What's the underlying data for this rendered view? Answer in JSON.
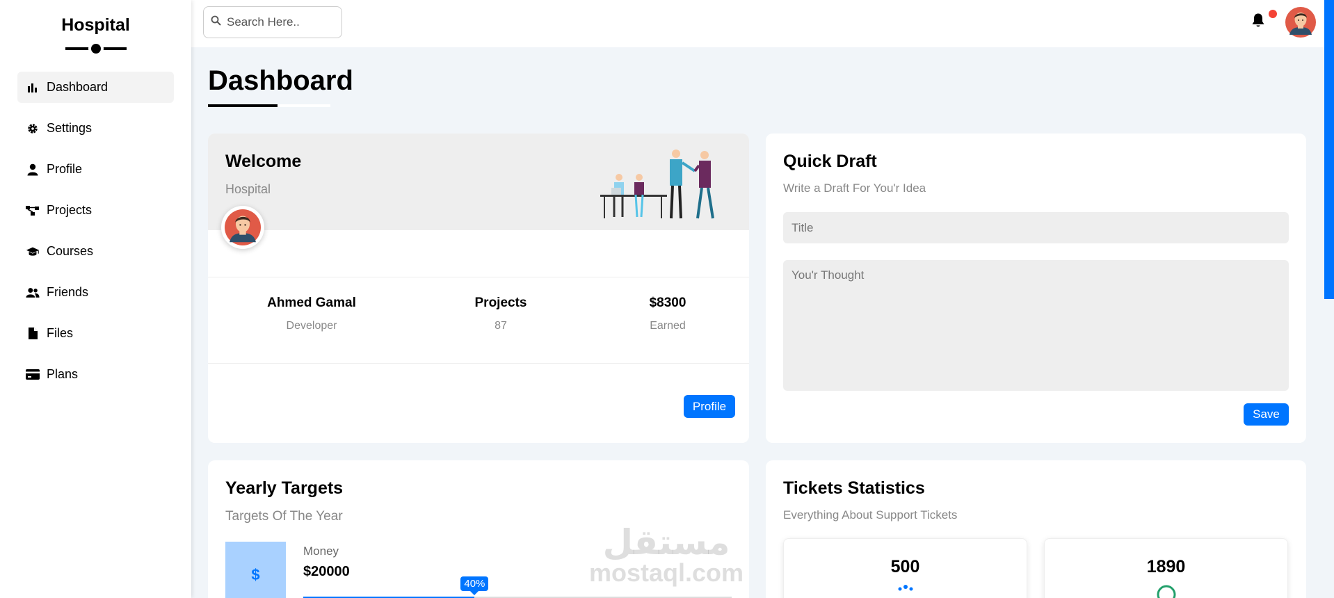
{
  "brand": {
    "name": "Hospital"
  },
  "sidebar": {
    "items": [
      {
        "label": "Dashboard",
        "icon": "chart-bar-icon",
        "active": true
      },
      {
        "label": "Settings",
        "icon": "gear-icon"
      },
      {
        "label": "Profile",
        "icon": "user-icon"
      },
      {
        "label": "Projects",
        "icon": "diagram-icon"
      },
      {
        "label": "Courses",
        "icon": "graduation-cap-icon"
      },
      {
        "label": "Friends",
        "icon": "users-icon"
      },
      {
        "label": "Files",
        "icon": "file-icon"
      },
      {
        "label": "Plans",
        "icon": "credit-card-icon"
      }
    ]
  },
  "header": {
    "search_placeholder": "Search Here.."
  },
  "page": {
    "title": "Dashboard"
  },
  "welcome": {
    "title": "Welcome",
    "subtitle": "Hospital",
    "stats": [
      {
        "value": "Ahmed Gamal",
        "label": "Developer"
      },
      {
        "value": "Projects",
        "label": "87"
      },
      {
        "value": "$8300",
        "label": "Earned"
      }
    ],
    "button": "Profile"
  },
  "draft": {
    "title": "Quick Draft",
    "subtitle": "Write a Draft For You'r Idea",
    "title_placeholder": "Title",
    "thought_placeholder": "You'r Thought",
    "button": "Save"
  },
  "targets": {
    "title": "Yearly Targets",
    "subtitle": "Targets Of The Year",
    "money_symbol": "$",
    "money_label": "Money",
    "money_value": "$20000",
    "progress_label": "40%",
    "progress_percent": 40
  },
  "tickets": {
    "title": "Tickets Statistics",
    "subtitle": "Everything About Support Tickets",
    "items": [
      {
        "value": "500"
      },
      {
        "value": "1890"
      }
    ]
  },
  "watermark": {
    "arabic": "مستقل",
    "latin": "mostaql.com"
  },
  "colors": {
    "accent": "#0075ff",
    "notification": "#f44336"
  }
}
